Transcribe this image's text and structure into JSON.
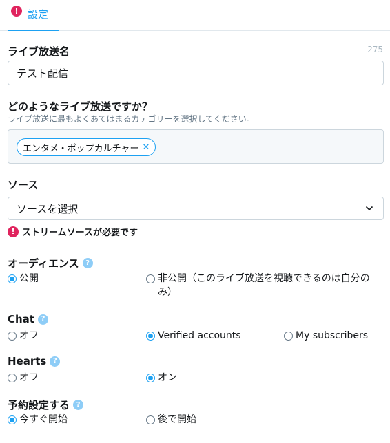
{
  "tab": {
    "label": "設定",
    "error_mark": "!"
  },
  "title_field": {
    "label": "ライブ放送名",
    "counter": "275",
    "value": "テスト配信"
  },
  "category": {
    "label": "どのようなライブ放送ですか？",
    "sub": "ライブ放送に最もよくあてはまるカテゴリーを選択してください。",
    "chip": "エンタメ・ポップカルチャー",
    "chip_remove": "✕"
  },
  "source": {
    "label": "ソース",
    "select_value": "ソースを選択",
    "error_mark": "!",
    "warning": "ストリームソースが必要です"
  },
  "audience": {
    "label": "オーディエンス",
    "help": "?",
    "options": [
      "公開",
      "非公開（このライブ放送を視聴できるのは自分のみ）"
    ],
    "option_line1": "非公開（このライブ放送を視聴できるのは自分の",
    "option_line2": "み）",
    "selected": 0
  },
  "chat": {
    "label": "Chat",
    "help": "?",
    "options": [
      "オフ",
      "Verified accounts",
      "My subscribers"
    ],
    "selected": 1
  },
  "hearts": {
    "label": "Hearts",
    "help": "?",
    "options": [
      "オフ",
      "オン"
    ],
    "selected": 1
  },
  "schedule": {
    "label": "予約設定する",
    "help": "?",
    "options": [
      "今すぐ開始",
      "後で開始"
    ],
    "selected": 0
  },
  "colors": {
    "accent": "#1da1f2",
    "error": "#e0245e",
    "help": "#8ecdf7"
  }
}
